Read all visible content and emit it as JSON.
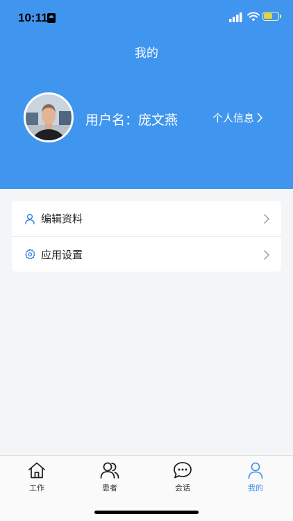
{
  "status_bar": {
    "time": "10:11"
  },
  "header": {
    "title": "我的",
    "username_label": "用户名：庞文燕",
    "profile_link": "个人信息"
  },
  "menu": {
    "items": [
      {
        "label": "编辑资料",
        "icon": "user-icon"
      },
      {
        "label": "应用设置",
        "icon": "gear-icon"
      }
    ]
  },
  "tabbar": {
    "tabs": [
      {
        "label": "工作",
        "icon": "home-icon",
        "active": false
      },
      {
        "label": "患者",
        "icon": "patients-icon",
        "active": false
      },
      {
        "label": "会话",
        "icon": "chat-icon",
        "active": false
      },
      {
        "label": "我的",
        "icon": "user-icon",
        "active": true
      }
    ]
  },
  "colors": {
    "header_bg": "#4095ee",
    "accent": "#3b8ce8",
    "page_bg": "#f4f5f7"
  }
}
